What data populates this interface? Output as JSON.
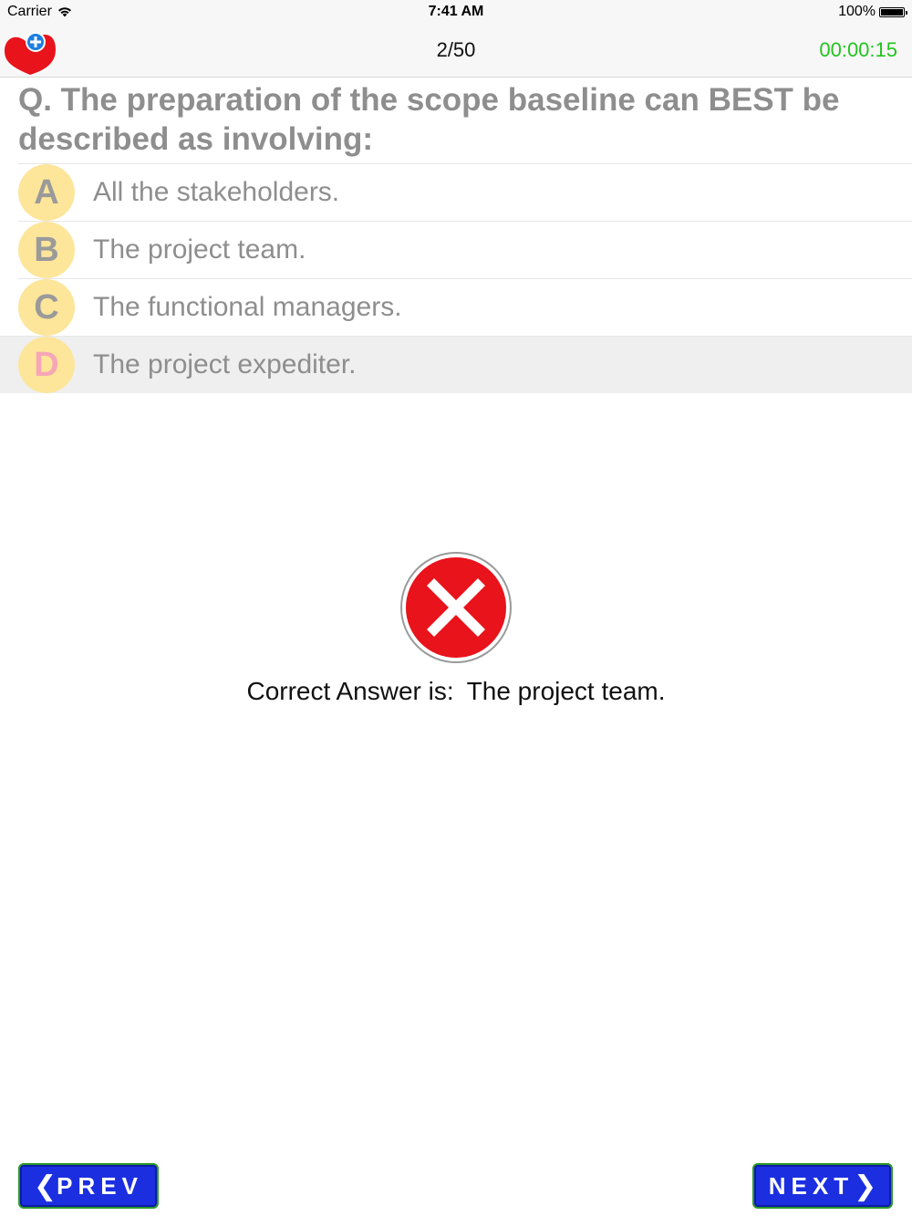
{
  "status_bar": {
    "carrier": "Carrier",
    "time": "7:41 AM",
    "battery": "100%"
  },
  "nav": {
    "counter": "2/50",
    "timer": "00:00:15",
    "favorite_icon": "heart-plus-icon"
  },
  "question": {
    "text": "Q. The preparation of the scope baseline can BEST be described as involving:",
    "options": [
      {
        "letter": "A",
        "text": "All the stakeholders."
      },
      {
        "letter": "B",
        "text": "The project team."
      },
      {
        "letter": "C",
        "text": "The functional managers."
      },
      {
        "letter": "D",
        "text": "The project expediter."
      }
    ],
    "selected": "D"
  },
  "result": {
    "icon": "wrong-x-icon",
    "label": "Correct Answer is:",
    "answer": "The project team."
  },
  "buttons": {
    "prev": "PREV",
    "next": "NEXT"
  },
  "colors": {
    "timer": "#22c41f",
    "button_bg": "#1b2fe0",
    "button_border": "#2a9a2a",
    "letter_bg": "#fde59a",
    "wrong_red": "#e8131b"
  }
}
